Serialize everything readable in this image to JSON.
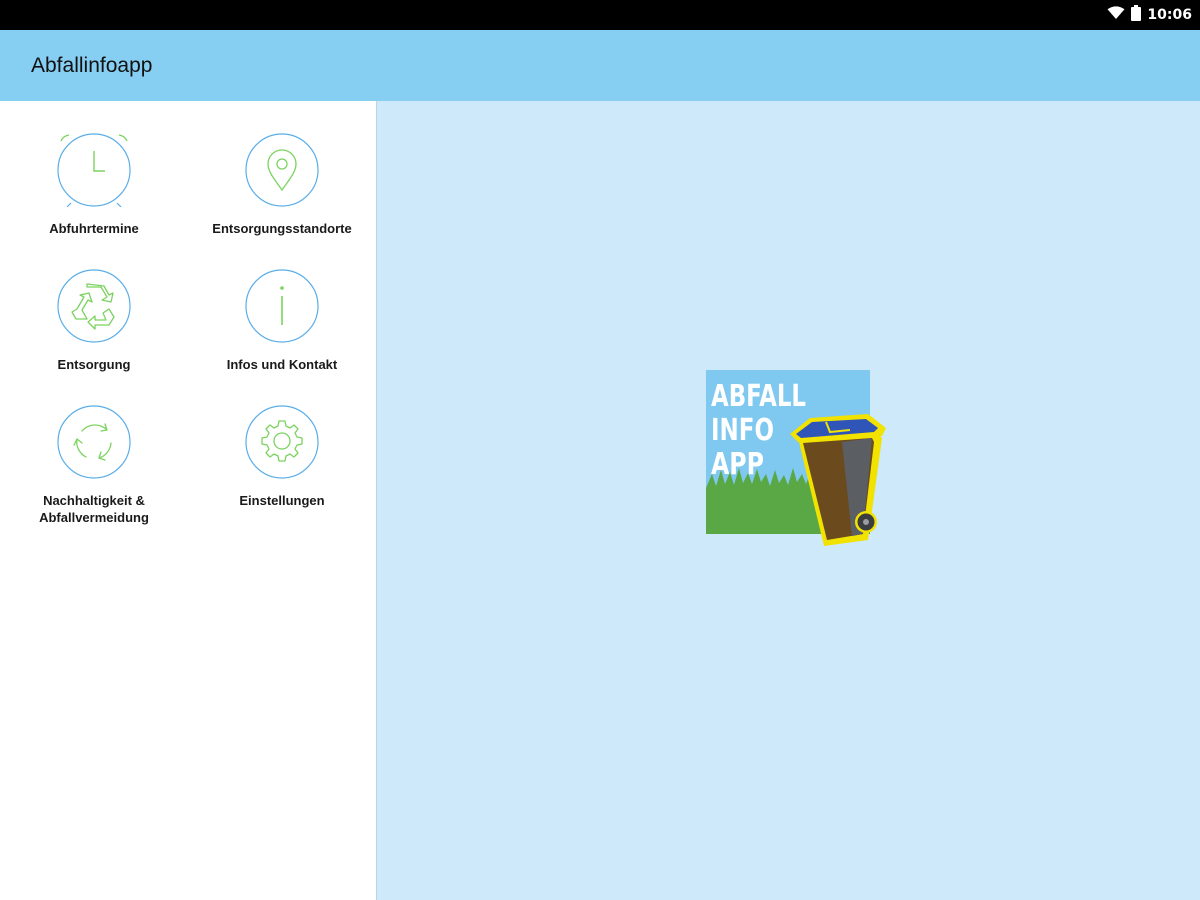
{
  "status_bar": {
    "time": "10:06",
    "icons": [
      "wifi-icon",
      "battery-icon"
    ]
  },
  "app_bar": {
    "title": "Abfallinfoapp"
  },
  "menu": {
    "items": [
      {
        "label": "Abfuhrtermine",
        "icon": "alarm-clock-icon"
      },
      {
        "label": "Entsorgungsstandorte",
        "icon": "location-pin-icon"
      },
      {
        "label": "Entsorgung",
        "icon": "recycle-icon"
      },
      {
        "label": "Infos und Kontakt",
        "icon": "info-icon"
      },
      {
        "label": "Nachhaltigkeit &\nAbfallvermeidung",
        "icon": "circular-arrows-icon"
      },
      {
        "label": "Einstellungen",
        "icon": "gear-icon"
      }
    ]
  },
  "logo": {
    "lines": [
      "ABFALL",
      "INFO",
      "APP"
    ]
  },
  "colors": {
    "status_bar": "#000000",
    "app_bar": "#86cff2",
    "content_bg": "#cde9fa",
    "icon_ring": "#5aaee8",
    "icon_green": "#7bd35f",
    "bin_yellow": "#f2e200",
    "bin_blue": "#2f55b8",
    "bin_brown": "#6b4a1e",
    "grass": "#5aa845"
  }
}
